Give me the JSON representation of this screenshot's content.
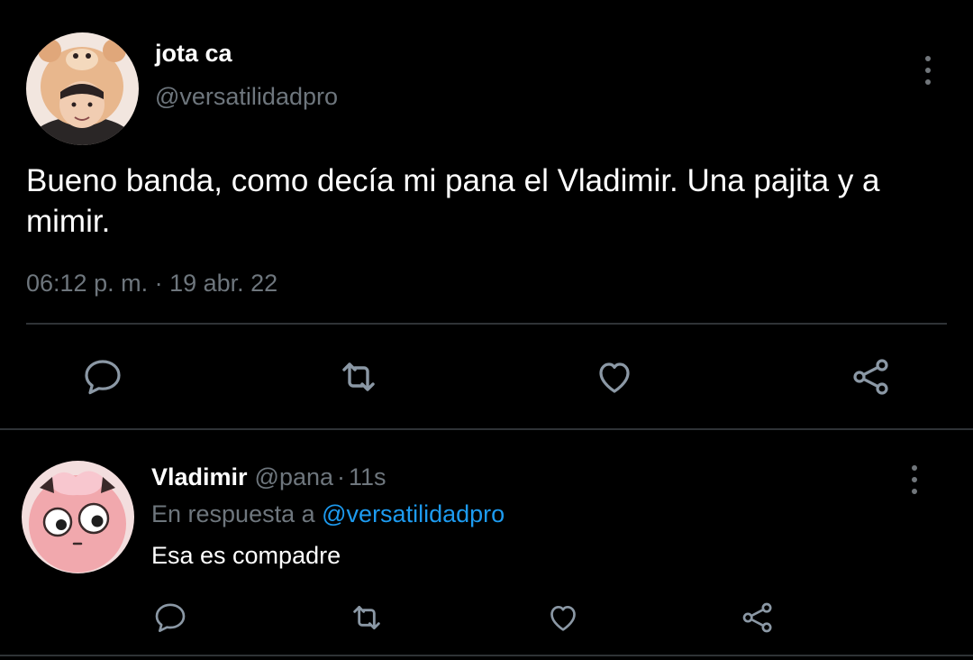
{
  "main_tweet": {
    "display_name": "jota ca",
    "handle": "@versatilidadpro",
    "text": "Bueno banda, como decía mi pana el Vladimir. Una pajita y a mimir.",
    "timestamp": "06:12 p. m. · 19 abr. 22",
    "actions": [
      "reply-icon",
      "retweet-icon",
      "like-icon",
      "share-icon"
    ]
  },
  "reply": {
    "display_name": "Vladimir",
    "handle": "@pana",
    "separator": "·",
    "time": "11s",
    "in_reply_to_label": "En respuesta a",
    "in_reply_to_handle": "@versatilidadpro",
    "text": "Esa es compadre",
    "actions": [
      "reply-icon",
      "retweet-icon",
      "like-icon",
      "share-icon"
    ]
  },
  "colors": {
    "background": "#000000",
    "primary_text": "#ffffff",
    "secondary_text": "#6e767d",
    "mention": "#1d9bf0",
    "divider": "#2f3336",
    "icon": "#8b98a5"
  }
}
